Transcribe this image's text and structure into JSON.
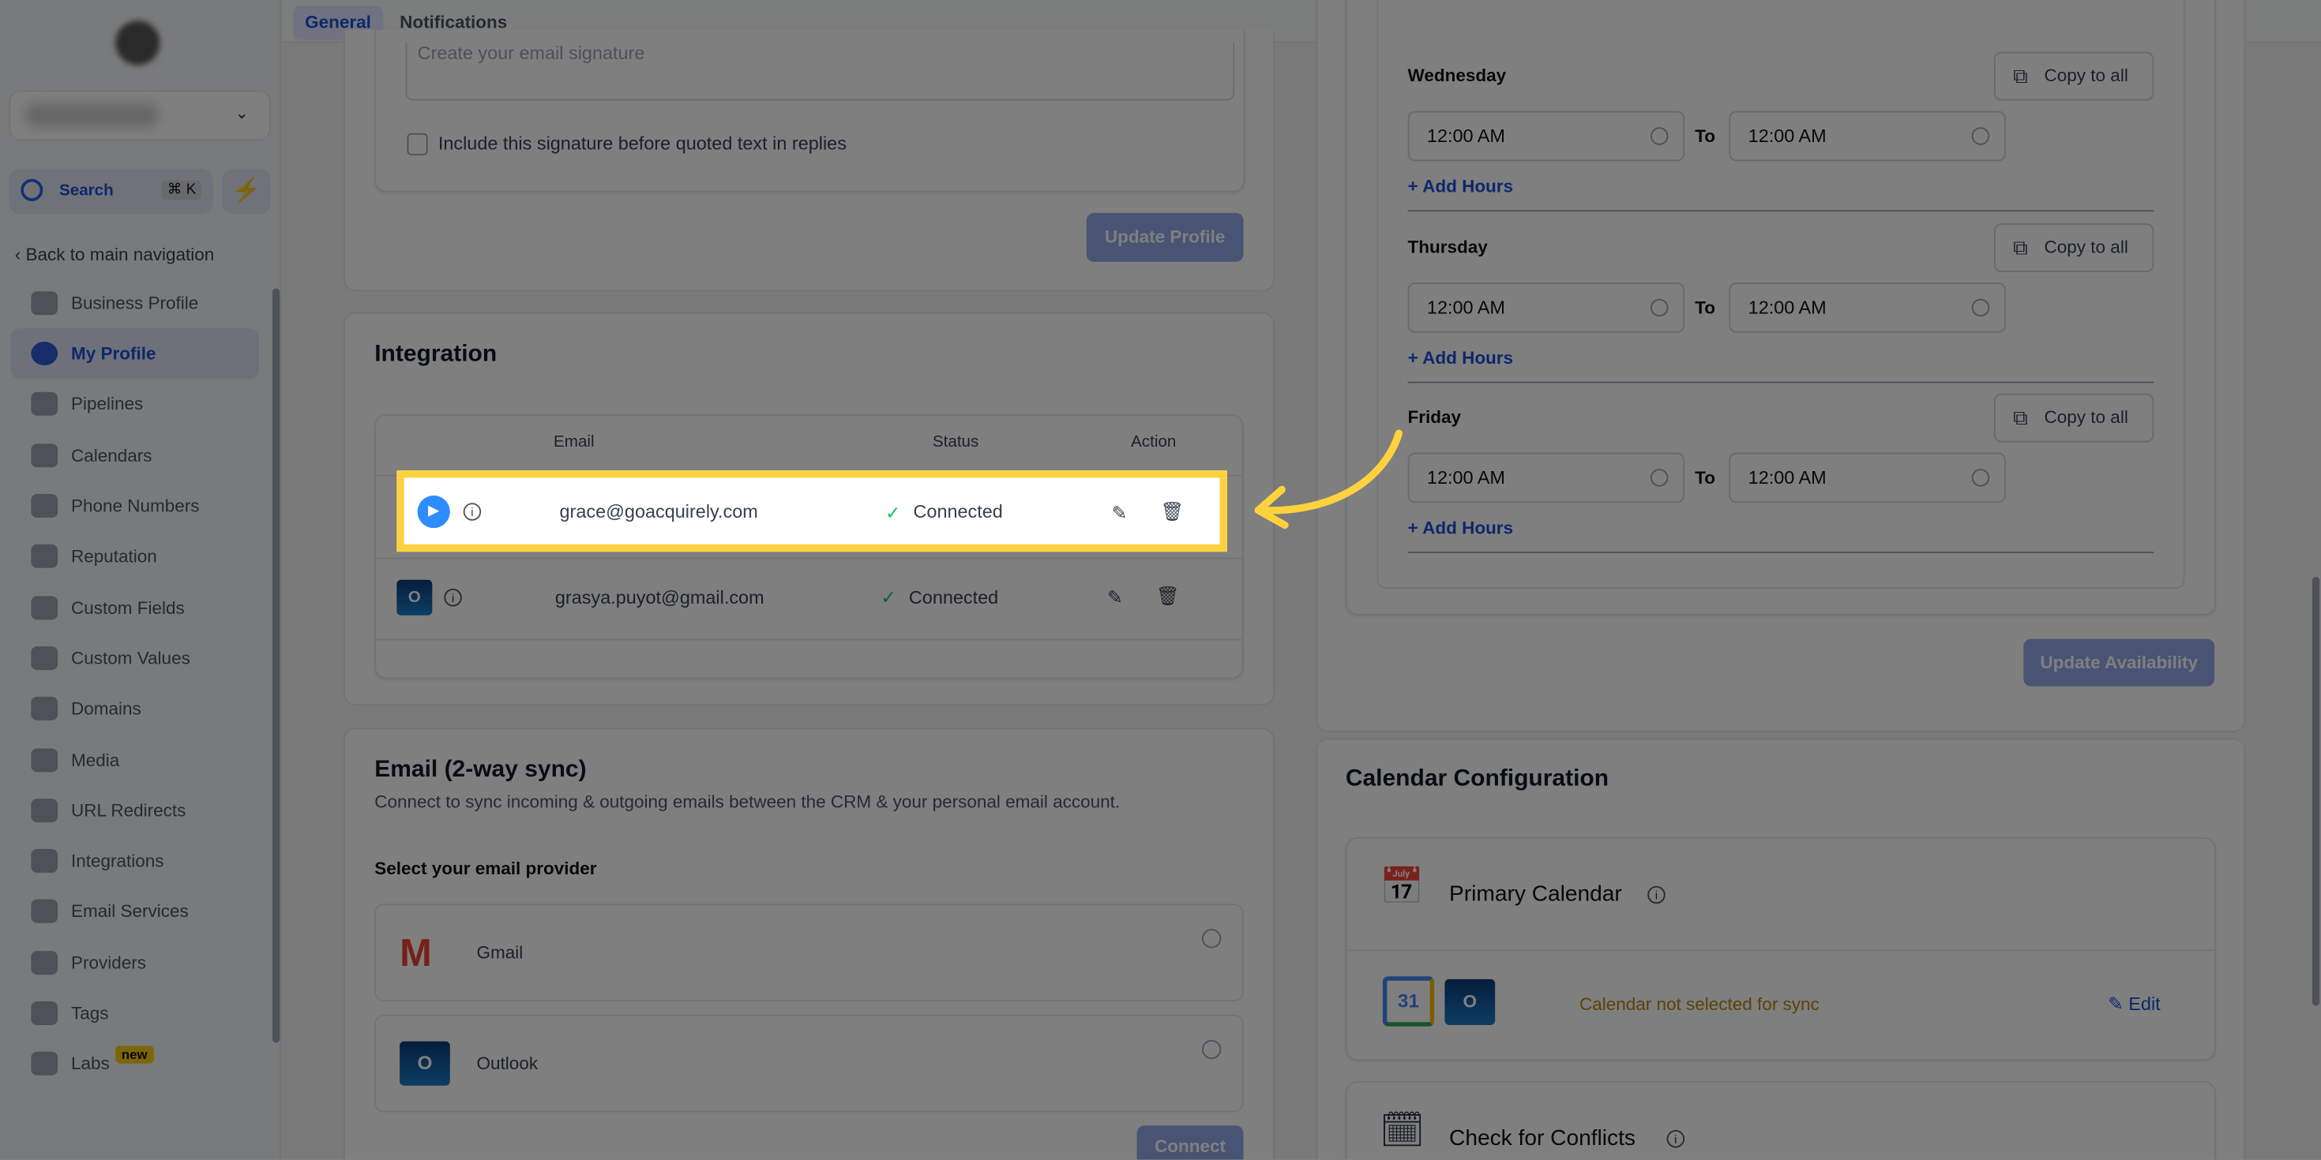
{
  "sidebar": {
    "search_label": "Search",
    "search_shortcut": "⌘ K",
    "back_label": "Back to main navigation",
    "items": [
      {
        "label": "Business Profile",
        "icon": "briefcase-icon"
      },
      {
        "label": "My Profile",
        "icon": "user-icon",
        "active": true
      },
      {
        "label": "Pipelines",
        "icon": "funnel-icon"
      },
      {
        "label": "Calendars",
        "icon": "calendar-icon"
      },
      {
        "label": "Phone Numbers",
        "icon": "phone-icon"
      },
      {
        "label": "Reputation",
        "icon": "star-icon"
      },
      {
        "label": "Custom Fields",
        "icon": "fields-icon"
      },
      {
        "label": "Custom Values",
        "icon": "gem-icon"
      },
      {
        "label": "Domains",
        "icon": "globe-icon"
      },
      {
        "label": "Media",
        "icon": "image-icon"
      },
      {
        "label": "URL Redirects",
        "icon": "redirect-icon"
      },
      {
        "label": "Integrations",
        "icon": "nodes-icon"
      },
      {
        "label": "Email Services",
        "icon": "mail-icon"
      },
      {
        "label": "Providers",
        "icon": "clipboard-icon"
      },
      {
        "label": "Tags",
        "icon": "tag-icon"
      },
      {
        "label": "Labs",
        "icon": "flask-icon",
        "badge": "new"
      }
    ]
  },
  "tabs": [
    {
      "label": "General",
      "active": true
    },
    {
      "label": "Notifications"
    }
  ],
  "signature": {
    "placeholder": "Create your email signature",
    "checkbox_label": "Include this signature before quoted text in replies",
    "update_button": "Update Profile"
  },
  "integration": {
    "title": "Integration",
    "columns": [
      "Email",
      "Status",
      "Action"
    ],
    "rows": [
      {
        "provider": "zoom",
        "email": "grace@goacquirely.com",
        "status": "Connected",
        "highlighted": true
      },
      {
        "provider": "outlook",
        "email": "grasya.puyot@gmail.com",
        "status": "Connected"
      }
    ]
  },
  "email_sync": {
    "title": "Email (2-way sync)",
    "description": "Connect to sync incoming & outgoing emails between the CRM & your personal email account.",
    "select_label": "Select your email provider",
    "providers": [
      "Gmail",
      "Outlook"
    ],
    "connect_button": "Connect"
  },
  "availability": {
    "days": [
      {
        "day": "Wednesday",
        "from": "12:00 AM",
        "to": "12:00 AM"
      },
      {
        "day": "Thursday",
        "from": "12:00 AM",
        "to": "12:00 AM"
      },
      {
        "day": "Friday",
        "from": "12:00 AM",
        "to": "12:00 AM"
      }
    ],
    "to_label": "To",
    "copy_label": "Copy to all",
    "add_hours": "+ Add Hours",
    "update_button": "Update Availability"
  },
  "calendar_config": {
    "title": "Calendar Configuration",
    "primary_title": "Primary Calendar",
    "status": "Calendar not selected for sync",
    "edit_label": "Edit",
    "conflicts_title": "Check for Conflicts"
  },
  "colors": {
    "highlight": "#fdd23e",
    "accent": "#1d4ed8",
    "connected": "#22c55e",
    "warning": "#b7860b"
  }
}
